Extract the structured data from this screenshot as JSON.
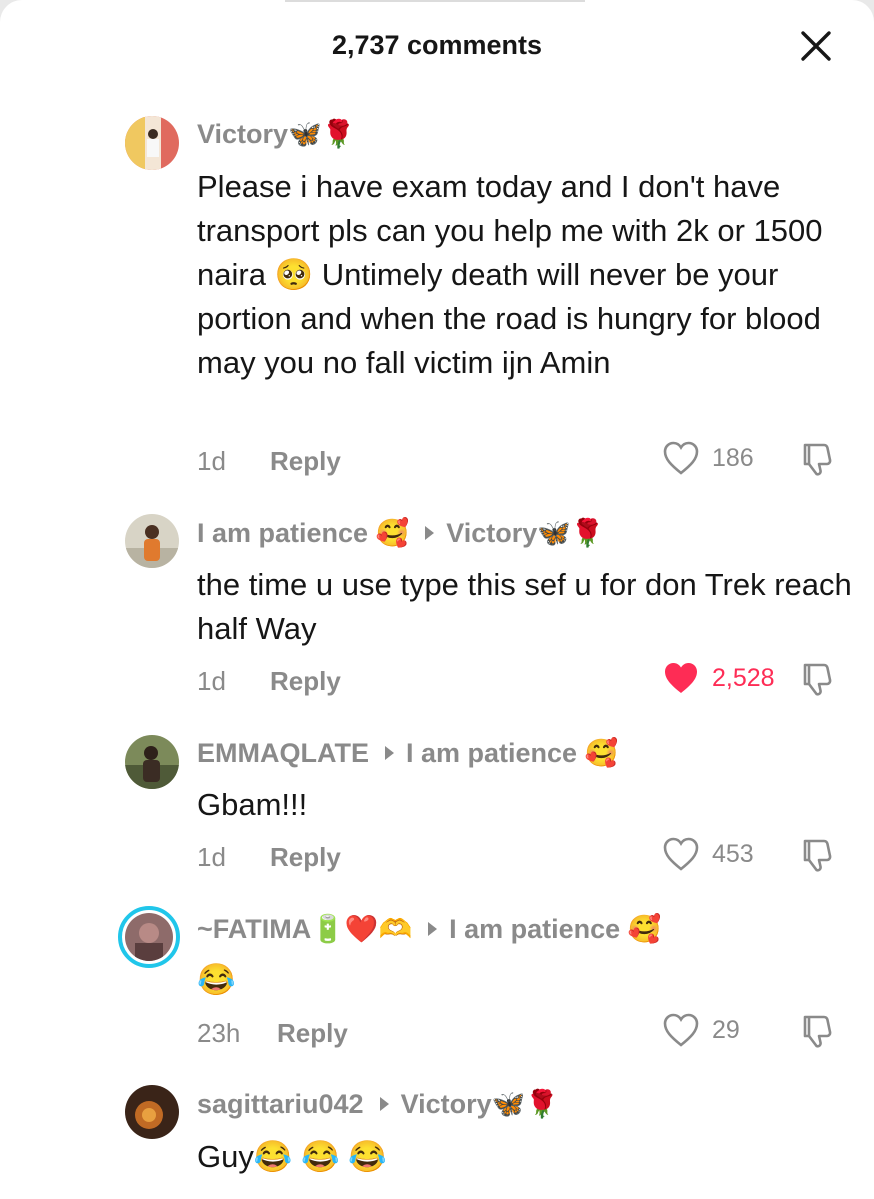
{
  "header": {
    "title": "2,737 comments"
  },
  "comments": [
    {
      "username": "Victory🦋🌹",
      "reply_to": "",
      "text": "Please i have exam today and I don't have transport pls can you help me with 2k or 1500 naira 🥺 Untimely death will never be your portion and when the road is hungry for blood may you no fall victim ijn Amin",
      "time": "1d",
      "reply_label": "Reply",
      "likes": "186",
      "liked": false
    },
    {
      "username": "I am patience 🥰",
      "reply_to": "Victory🦋🌹",
      "text": "the time u use type this sef u for don Trek reach half Way",
      "time": "1d",
      "reply_label": "Reply",
      "likes": "2,528",
      "liked": true
    },
    {
      "username": "EMMAQLATE",
      "reply_to": "I am patience 🥰",
      "text": "Gbam!!!",
      "time": "1d",
      "reply_label": "Reply",
      "likes": "453",
      "liked": false
    },
    {
      "username": "~FATIMA🔋❤️🫶",
      "reply_to": "I am patience 🥰",
      "text": "😂",
      "time": "23h",
      "reply_label": "Reply",
      "likes": "29",
      "liked": false
    },
    {
      "username": "sagittariu042",
      "reply_to": "Victory🦋🌹",
      "text": "Guy😂 😂 😂",
      "time": "",
      "reply_label": "",
      "likes": "",
      "liked": false
    }
  ],
  "colors": {
    "accent_like": "#fe2c55",
    "muted": "#8a8a8a",
    "text": "#161616",
    "story_ring": "#20c6ea"
  },
  "icons": [
    "close-icon",
    "heart-icon",
    "heart-filled-icon",
    "dislike-icon",
    "caret-right-icon"
  ]
}
